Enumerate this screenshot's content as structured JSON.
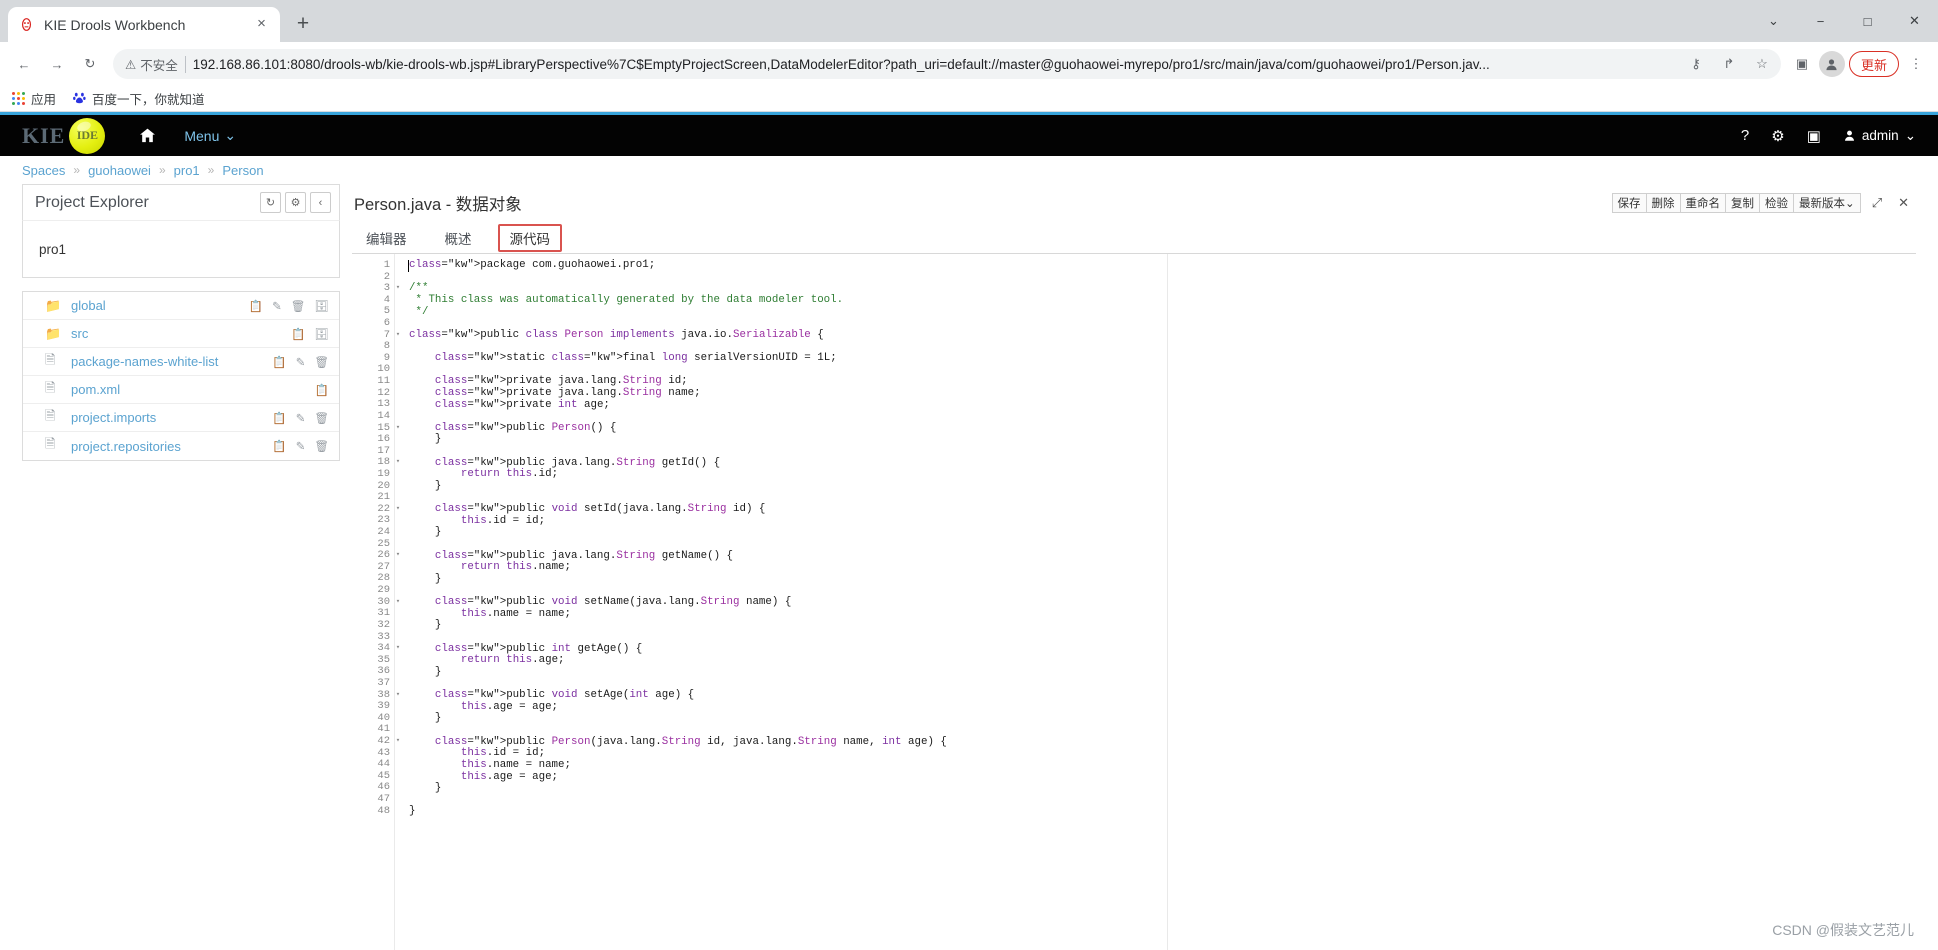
{
  "browser": {
    "tab": {
      "title": "KIE Drools Workbench",
      "favicon": "drools-favicon",
      "close_label": "×"
    },
    "new_tab_label": "+",
    "window_buttons": {
      "minimize": "−",
      "maximize": "□",
      "close": "✕",
      "expand": "⌄"
    },
    "nav": {
      "back": "←",
      "forward": "→",
      "reload": "↻"
    },
    "omnibox": {
      "security_label": "不安全",
      "warning_icon": "warning-triangle-icon",
      "url": "192.168.86.101:8080/drools-wb/kie-drools-wb.jsp#LibraryPerspective%7C$EmptyProjectScreen,DataModelerEditor?path_uri=default://master@guohaowei-myrepo/pro1/src/main/java/com/guohaowei/pro1/Person.jav...",
      "key_icon": "⚷",
      "share_icon": "↱",
      "bookmark_icon": "☆"
    },
    "toolbar_right": {
      "sidepanel_icon": "▣",
      "profile_icon": "●",
      "update_label": "更新",
      "menu_dots": "⋮"
    },
    "bookmarks": [
      {
        "label": "应用",
        "icon": "apps-grid-icon"
      },
      {
        "label": "百度一下，你就知道",
        "icon": "baidu-icon"
      }
    ]
  },
  "kie": {
    "logo_text": "KIE",
    "logo_ball_text": "IDE",
    "home_icon": "home-icon",
    "menu_label": "Menu",
    "menu_caret": "⌄",
    "right_icons": [
      {
        "name": "help-icon",
        "glyph": "?"
      },
      {
        "name": "gear-icon",
        "glyph": "⚙"
      },
      {
        "name": "camera-icon",
        "glyph": "▣"
      }
    ],
    "user": {
      "icon": "●",
      "label": "admin",
      "caret": "⌄"
    }
  },
  "breadcrumb": {
    "items": [
      "Spaces",
      "guohaowei",
      "pro1",
      "Person"
    ],
    "separator": "»"
  },
  "explorer": {
    "title": "Project Explorer",
    "buttons": [
      {
        "name": "refresh-button",
        "glyph": "↻"
      },
      {
        "name": "settings-button",
        "glyph": "⚙"
      },
      {
        "name": "collapse-button",
        "glyph": "‹"
      }
    ],
    "project": "pro1",
    "files": [
      {
        "name": "global",
        "type": "folder",
        "actions": [
          "copy",
          "edit",
          "delete",
          "archive"
        ]
      },
      {
        "name": "src",
        "type": "folder",
        "actions": [
          "copy",
          "archive"
        ]
      },
      {
        "name": "package-names-white-list",
        "type": "file",
        "actions": [
          "copy",
          "edit",
          "delete"
        ]
      },
      {
        "name": "pom.xml",
        "type": "file",
        "actions": [
          "copy"
        ]
      },
      {
        "name": "project.imports",
        "type": "file",
        "actions": [
          "copy",
          "edit",
          "delete"
        ]
      },
      {
        "name": "project.repositories",
        "type": "file",
        "actions": [
          "copy",
          "edit",
          "delete"
        ]
      }
    ]
  },
  "editor": {
    "title": "Person.java - 数据对象",
    "toolbar": [
      {
        "name": "save-button",
        "label": "保存"
      },
      {
        "name": "delete-button",
        "label": "删除"
      },
      {
        "name": "rename-button",
        "label": "重命名"
      },
      {
        "name": "copy-button",
        "label": "复制"
      },
      {
        "name": "validate-button",
        "label": "检验"
      },
      {
        "name": "latest-version-button",
        "label": "最新版本⌄"
      }
    ],
    "window_controls": [
      {
        "name": "maximize-editor-button",
        "glyph": "⤢"
      },
      {
        "name": "close-editor-button",
        "glyph": "✕"
      }
    ],
    "tabs": [
      {
        "name": "tab-editor",
        "label": "编辑器",
        "active": false
      },
      {
        "name": "tab-overview",
        "label": "概述",
        "active": false
      },
      {
        "name": "tab-source",
        "label": "源代码",
        "active": true
      }
    ],
    "active_tab_border_color": "#d9534f",
    "code_lines": [
      {
        "n": 1,
        "fold": false,
        "text": "package com.guohaowei.pro1;"
      },
      {
        "n": 2,
        "fold": false,
        "text": ""
      },
      {
        "n": 3,
        "fold": true,
        "text": "/**"
      },
      {
        "n": 4,
        "fold": false,
        "text": " * This class was automatically generated by the data modeler tool."
      },
      {
        "n": 5,
        "fold": false,
        "text": " */"
      },
      {
        "n": 6,
        "fold": false,
        "text": ""
      },
      {
        "n": 7,
        "fold": true,
        "text": "public class Person implements java.io.Serializable {"
      },
      {
        "n": 8,
        "fold": false,
        "text": ""
      },
      {
        "n": 9,
        "fold": false,
        "text": "    static final long serialVersionUID = 1L;"
      },
      {
        "n": 10,
        "fold": false,
        "text": ""
      },
      {
        "n": 11,
        "fold": false,
        "text": "    private java.lang.String id;"
      },
      {
        "n": 12,
        "fold": false,
        "text": "    private java.lang.String name;"
      },
      {
        "n": 13,
        "fold": false,
        "text": "    private int age;"
      },
      {
        "n": 14,
        "fold": false,
        "text": ""
      },
      {
        "n": 15,
        "fold": true,
        "text": "    public Person() {"
      },
      {
        "n": 16,
        "fold": false,
        "text": "    }"
      },
      {
        "n": 17,
        "fold": false,
        "text": ""
      },
      {
        "n": 18,
        "fold": true,
        "text": "    public java.lang.String getId() {"
      },
      {
        "n": 19,
        "fold": false,
        "text": "        return this.id;"
      },
      {
        "n": 20,
        "fold": false,
        "text": "    }"
      },
      {
        "n": 21,
        "fold": false,
        "text": ""
      },
      {
        "n": 22,
        "fold": true,
        "text": "    public void setId(java.lang.String id) {"
      },
      {
        "n": 23,
        "fold": false,
        "text": "        this.id = id;"
      },
      {
        "n": 24,
        "fold": false,
        "text": "    }"
      },
      {
        "n": 25,
        "fold": false,
        "text": ""
      },
      {
        "n": 26,
        "fold": true,
        "text": "    public java.lang.String getName() {"
      },
      {
        "n": 27,
        "fold": false,
        "text": "        return this.name;"
      },
      {
        "n": 28,
        "fold": false,
        "text": "    }"
      },
      {
        "n": 29,
        "fold": false,
        "text": ""
      },
      {
        "n": 30,
        "fold": true,
        "text": "    public void setName(java.lang.String name) {"
      },
      {
        "n": 31,
        "fold": false,
        "text": "        this.name = name;"
      },
      {
        "n": 32,
        "fold": false,
        "text": "    }"
      },
      {
        "n": 33,
        "fold": false,
        "text": ""
      },
      {
        "n": 34,
        "fold": true,
        "text": "    public int getAge() {"
      },
      {
        "n": 35,
        "fold": false,
        "text": "        return this.age;"
      },
      {
        "n": 36,
        "fold": false,
        "text": "    }"
      },
      {
        "n": 37,
        "fold": false,
        "text": ""
      },
      {
        "n": 38,
        "fold": true,
        "text": "    public void setAge(int age) {"
      },
      {
        "n": 39,
        "fold": false,
        "text": "        this.age = age;"
      },
      {
        "n": 40,
        "fold": false,
        "text": "    }"
      },
      {
        "n": 41,
        "fold": false,
        "text": ""
      },
      {
        "n": 42,
        "fold": true,
        "text": "    public Person(java.lang.String id, java.lang.String name, int age) {"
      },
      {
        "n": 43,
        "fold": false,
        "text": "        this.id = id;"
      },
      {
        "n": 44,
        "fold": false,
        "text": "        this.name = name;"
      },
      {
        "n": 45,
        "fold": false,
        "text": "        this.age = age;"
      },
      {
        "n": 46,
        "fold": false,
        "text": "    }"
      },
      {
        "n": 47,
        "fold": false,
        "text": ""
      },
      {
        "n": 48,
        "fold": false,
        "text": "}"
      }
    ]
  },
  "watermark": "CSDN @假装文艺范儿"
}
